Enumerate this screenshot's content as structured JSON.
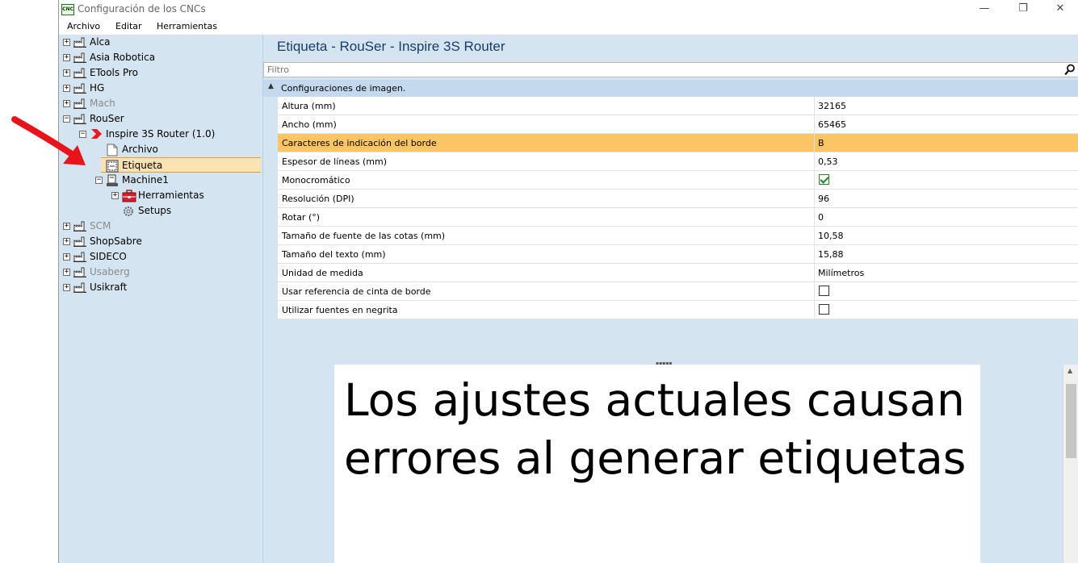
{
  "window": {
    "icon_text": "CNC",
    "title": "Configuración de los CNCs",
    "minimize_symbol": "—",
    "maximize_symbol": "❐",
    "close_symbol": "✕"
  },
  "menu": {
    "items": [
      "Archivo",
      "Editar",
      "Herramientas"
    ]
  },
  "tree": {
    "items": [
      {
        "label": "Alca",
        "icon": "factory-icon",
        "expander": "+",
        "disabled": false
      },
      {
        "label": "Asia Robotica",
        "icon": "factory-icon",
        "expander": "+",
        "disabled": false
      },
      {
        "label": "ETools Pro",
        "icon": "factory-icon",
        "expander": "+",
        "disabled": false
      },
      {
        "label": "HG",
        "icon": "factory-icon",
        "expander": "+",
        "disabled": false
      },
      {
        "label": "Mach",
        "icon": "factory-icon",
        "expander": "+",
        "disabled": true
      },
      {
        "label": "RouSer",
        "icon": "factory-icon",
        "expander": "−",
        "disabled": false
      },
      {
        "label": "Inspire 3S Router (1.0)",
        "icon": "chevron-marker-icon",
        "expander": "−",
        "disabled": false
      },
      {
        "label": "Archivo",
        "icon": "file-icon",
        "expander": "",
        "disabled": false
      },
      {
        "label": "Etiqueta",
        "icon": "label-icon",
        "expander": "",
        "disabled": false,
        "selected": true
      },
      {
        "label": "Machine1",
        "icon": "machine-icon",
        "expander": "−",
        "disabled": false
      },
      {
        "label": "Herramientas",
        "icon": "toolbox-icon",
        "expander": "+",
        "disabled": false
      },
      {
        "label": "Setups",
        "icon": "gear-icon",
        "expander": "",
        "disabled": false
      },
      {
        "label": "SCM",
        "icon": "factory-icon",
        "expander": "+",
        "disabled": true
      },
      {
        "label": "ShopSabre",
        "icon": "factory-icon",
        "expander": "+",
        "disabled": false
      },
      {
        "label": "SIDECO",
        "icon": "factory-icon",
        "expander": "+",
        "disabled": false
      },
      {
        "label": "Usaberg",
        "icon": "factory-icon",
        "expander": "+",
        "disabled": true
      },
      {
        "label": "Usikraft",
        "icon": "factory-icon",
        "expander": "+",
        "disabled": false
      }
    ]
  },
  "panel": {
    "title": "Etiqueta - RouSer - Inspire 3S Router",
    "filter_placeholder": "Filtro",
    "group_label": "Configuraciones de imagen.",
    "properties": [
      {
        "name": "Altura (mm)",
        "value": "32165"
      },
      {
        "name": "Ancho (mm)",
        "value": "65465"
      },
      {
        "name": "Caracteres de indicación del borde",
        "value": "B",
        "highlight": true
      },
      {
        "name": "Espesor de líneas (mm)",
        "value": "0,53"
      },
      {
        "name": "Monocromático",
        "checkbox": true,
        "checked": true
      },
      {
        "name": "Resolución (DPI)",
        "value": "96"
      },
      {
        "name": "Rotar (°)",
        "value": "0"
      },
      {
        "name": "Tamaño de fuente de las cotas (mm)",
        "value": "10,58"
      },
      {
        "name": "Tamaño del texto (mm)",
        "value": "15,88"
      },
      {
        "name": "Unidad de medida",
        "value": "Milímetros"
      },
      {
        "name": "Usar referencia de cinta de borde",
        "checkbox": true,
        "checked": false
      },
      {
        "name": "Utilizar fuentes en negrita",
        "checkbox": true,
        "checked": false
      }
    ]
  },
  "preview": {
    "message": "Los ajustes actuales causan errores al generar etiquetas"
  },
  "colors": {
    "tree_bg": "#d5e4f1",
    "selection": "#fde2b4",
    "row_highlight": "#fbc565",
    "annotation_arrow": "#e8141b"
  }
}
